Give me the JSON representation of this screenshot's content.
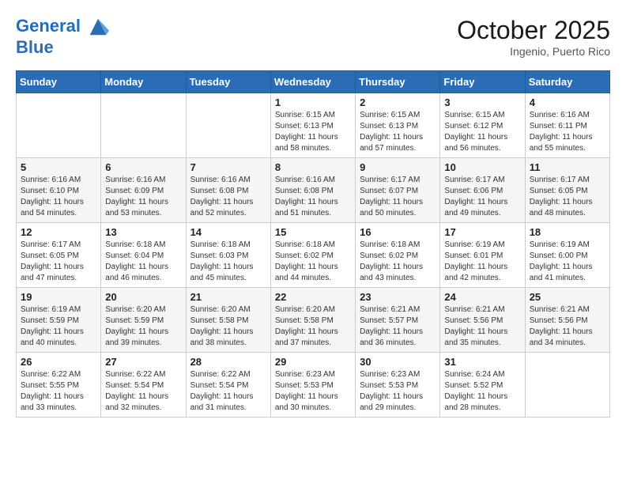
{
  "header": {
    "logo_line1": "General",
    "logo_line2": "Blue",
    "month_title": "October 2025",
    "subtitle": "Ingenio, Puerto Rico"
  },
  "days_of_week": [
    "Sunday",
    "Monday",
    "Tuesday",
    "Wednesday",
    "Thursday",
    "Friday",
    "Saturday"
  ],
  "weeks": [
    [
      {
        "day": "",
        "info": ""
      },
      {
        "day": "",
        "info": ""
      },
      {
        "day": "",
        "info": ""
      },
      {
        "day": "1",
        "info": "Sunrise: 6:15 AM\nSunset: 6:13 PM\nDaylight: 11 hours\nand 58 minutes."
      },
      {
        "day": "2",
        "info": "Sunrise: 6:15 AM\nSunset: 6:13 PM\nDaylight: 11 hours\nand 57 minutes."
      },
      {
        "day": "3",
        "info": "Sunrise: 6:15 AM\nSunset: 6:12 PM\nDaylight: 11 hours\nand 56 minutes."
      },
      {
        "day": "4",
        "info": "Sunrise: 6:16 AM\nSunset: 6:11 PM\nDaylight: 11 hours\nand 55 minutes."
      }
    ],
    [
      {
        "day": "5",
        "info": "Sunrise: 6:16 AM\nSunset: 6:10 PM\nDaylight: 11 hours\nand 54 minutes."
      },
      {
        "day": "6",
        "info": "Sunrise: 6:16 AM\nSunset: 6:09 PM\nDaylight: 11 hours\nand 53 minutes."
      },
      {
        "day": "7",
        "info": "Sunrise: 6:16 AM\nSunset: 6:08 PM\nDaylight: 11 hours\nand 52 minutes."
      },
      {
        "day": "8",
        "info": "Sunrise: 6:16 AM\nSunset: 6:08 PM\nDaylight: 11 hours\nand 51 minutes."
      },
      {
        "day": "9",
        "info": "Sunrise: 6:17 AM\nSunset: 6:07 PM\nDaylight: 11 hours\nand 50 minutes."
      },
      {
        "day": "10",
        "info": "Sunrise: 6:17 AM\nSunset: 6:06 PM\nDaylight: 11 hours\nand 49 minutes."
      },
      {
        "day": "11",
        "info": "Sunrise: 6:17 AM\nSunset: 6:05 PM\nDaylight: 11 hours\nand 48 minutes."
      }
    ],
    [
      {
        "day": "12",
        "info": "Sunrise: 6:17 AM\nSunset: 6:05 PM\nDaylight: 11 hours\nand 47 minutes."
      },
      {
        "day": "13",
        "info": "Sunrise: 6:18 AM\nSunset: 6:04 PM\nDaylight: 11 hours\nand 46 minutes."
      },
      {
        "day": "14",
        "info": "Sunrise: 6:18 AM\nSunset: 6:03 PM\nDaylight: 11 hours\nand 45 minutes."
      },
      {
        "day": "15",
        "info": "Sunrise: 6:18 AM\nSunset: 6:02 PM\nDaylight: 11 hours\nand 44 minutes."
      },
      {
        "day": "16",
        "info": "Sunrise: 6:18 AM\nSunset: 6:02 PM\nDaylight: 11 hours\nand 43 minutes."
      },
      {
        "day": "17",
        "info": "Sunrise: 6:19 AM\nSunset: 6:01 PM\nDaylight: 11 hours\nand 42 minutes."
      },
      {
        "day": "18",
        "info": "Sunrise: 6:19 AM\nSunset: 6:00 PM\nDaylight: 11 hours\nand 41 minutes."
      }
    ],
    [
      {
        "day": "19",
        "info": "Sunrise: 6:19 AM\nSunset: 5:59 PM\nDaylight: 11 hours\nand 40 minutes."
      },
      {
        "day": "20",
        "info": "Sunrise: 6:20 AM\nSunset: 5:59 PM\nDaylight: 11 hours\nand 39 minutes."
      },
      {
        "day": "21",
        "info": "Sunrise: 6:20 AM\nSunset: 5:58 PM\nDaylight: 11 hours\nand 38 minutes."
      },
      {
        "day": "22",
        "info": "Sunrise: 6:20 AM\nSunset: 5:58 PM\nDaylight: 11 hours\nand 37 minutes."
      },
      {
        "day": "23",
        "info": "Sunrise: 6:21 AM\nSunset: 5:57 PM\nDaylight: 11 hours\nand 36 minutes."
      },
      {
        "day": "24",
        "info": "Sunrise: 6:21 AM\nSunset: 5:56 PM\nDaylight: 11 hours\nand 35 minutes."
      },
      {
        "day": "25",
        "info": "Sunrise: 6:21 AM\nSunset: 5:56 PM\nDaylight: 11 hours\nand 34 minutes."
      }
    ],
    [
      {
        "day": "26",
        "info": "Sunrise: 6:22 AM\nSunset: 5:55 PM\nDaylight: 11 hours\nand 33 minutes."
      },
      {
        "day": "27",
        "info": "Sunrise: 6:22 AM\nSunset: 5:54 PM\nDaylight: 11 hours\nand 32 minutes."
      },
      {
        "day": "28",
        "info": "Sunrise: 6:22 AM\nSunset: 5:54 PM\nDaylight: 11 hours\nand 31 minutes."
      },
      {
        "day": "29",
        "info": "Sunrise: 6:23 AM\nSunset: 5:53 PM\nDaylight: 11 hours\nand 30 minutes."
      },
      {
        "day": "30",
        "info": "Sunrise: 6:23 AM\nSunset: 5:53 PM\nDaylight: 11 hours\nand 29 minutes."
      },
      {
        "day": "31",
        "info": "Sunrise: 6:24 AM\nSunset: 5:52 PM\nDaylight: 11 hours\nand 28 minutes."
      },
      {
        "day": "",
        "info": ""
      }
    ]
  ]
}
